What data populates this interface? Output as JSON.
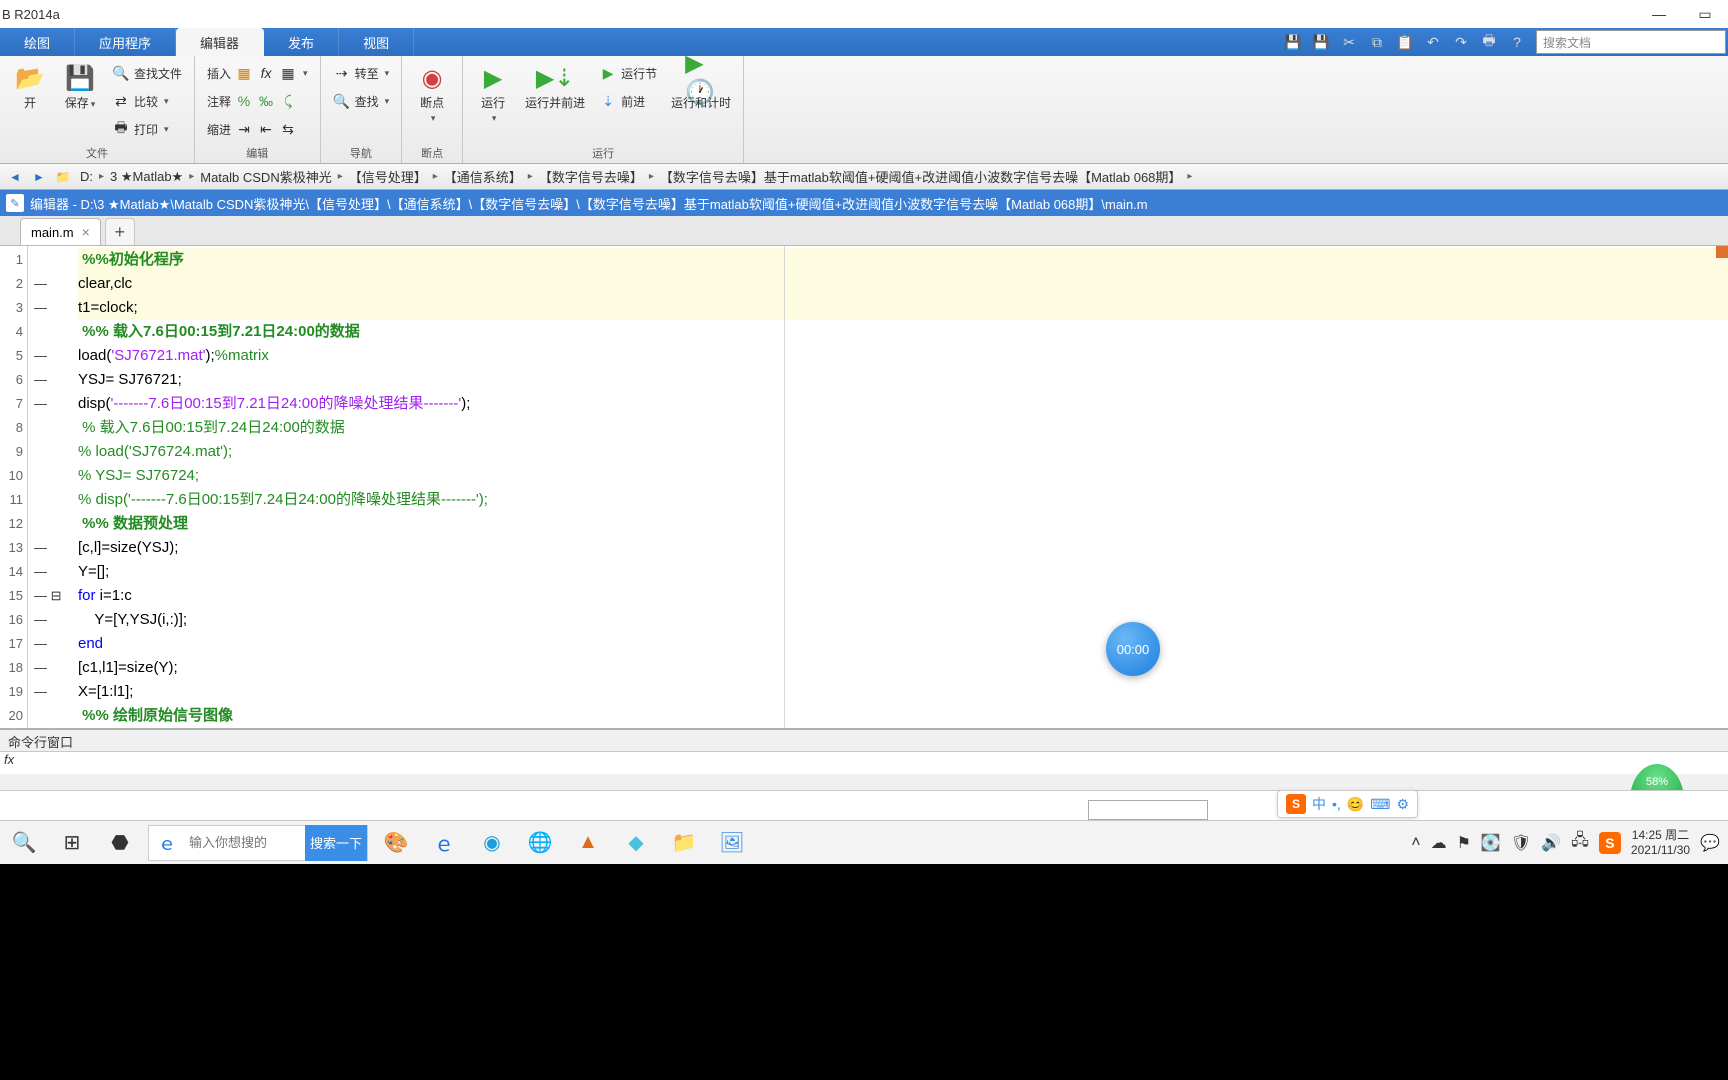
{
  "title": "B R2014a",
  "window": {
    "minimize": "—",
    "maximize": "▭"
  },
  "tabs": {
    "plot": "绘图",
    "apps": "应用程序",
    "editor": "编辑器",
    "publish": "发布",
    "view": "视图"
  },
  "search_placeholder": "搜索文档",
  "ribbon": {
    "file_group": "文件",
    "open": "开",
    "save": "保存",
    "findfiles": "查找文件",
    "compare": "比较",
    "print": "打印",
    "edit_group": "编辑",
    "insert": "插入",
    "fx": "fx",
    "comment": "注释",
    "indent": "缩进",
    "nav_group": "导航",
    "goto": "转至",
    "find": "查找",
    "bp_group": "断点",
    "bp": "断点",
    "run_group": "运行",
    "run": "运行",
    "runadv": "运行并前进",
    "runsec": "运行节",
    "advance": "前进",
    "runtime": "运行和计时"
  },
  "breadcrumbs": [
    "D:",
    "3 ★Matlab★",
    "Matalb CSDN紫极神光",
    "【信号处理】",
    "【通信系统】",
    "【数字信号去噪】",
    "【数字信号去噪】基于matlab软阈值+硬阈值+改进阈值小波数字信号去噪【Matlab 068期】"
  ],
  "editor_title": "编辑器 - D:\\3 ★Matlab★\\Matalb CSDN紫极神光\\【信号处理】\\【通信系统】\\【数字信号去噪】\\【数字信号去噪】基于matlab软阈值+硬阈值+改进阈值小波数字信号去噪【Matlab 068期】\\main.m",
  "filetab": "main.m",
  "code": {
    "l1": "%%初始化程序",
    "l2": "clear,clc",
    "l3": "t1=clock;",
    "l4a": "%% 载入7.6日00:15到7.21日24:00的数据",
    "l5a": "load(",
    "l5b": "'SJ76721.mat'",
    "l5c": ");",
    "l5d": "%matrix",
    "l6": "YSJ= SJ76721;",
    "l7a": "disp(",
    "l7b": "'-------7.6日00:15到7.21日24:00的降噪处理结果-------'",
    "l7c": ");",
    "l8": " % 载入7.6日00:15到7.24日24:00的数据",
    "l9": "% load('SJ76724.mat');",
    "l10": "% YSJ= SJ76724;",
    "l11": "% disp('-------7.6日00:15到7.24日24:00的降噪处理结果-------');",
    "l12": "%% 数据预处理",
    "l13": "[c,l]=size(YSJ);",
    "l14": "Y=[];",
    "l15a": "for",
    "l15b": " i=1:c",
    "l16": "    Y=[Y,YSJ(i,:)];",
    "l17": "end",
    "l18": "[c1,l1]=size(Y);",
    "l19": "X=[1:l1];",
    "l20": "%% 绘制原始信号图像"
  },
  "cmd_label": "命令行窗口",
  "cmd_prompt": "fx",
  "timer": "00:00",
  "greenpct": "58%",
  "taskbar": {
    "search_ph": "输入你想搜的",
    "search_btn": "搜索一下",
    "ime_cn": "中",
    "time": "14:25",
    "day": "周二",
    "date": "2021/11/30"
  }
}
